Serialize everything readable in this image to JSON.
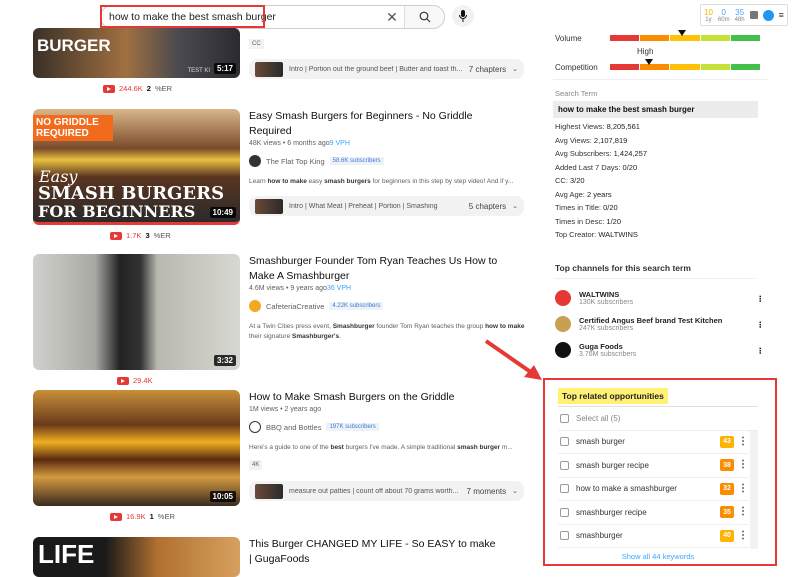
{
  "search": {
    "query": "how to make the best smash burger"
  },
  "extension_stats": {
    "count_1y": "10",
    "label_1y": "1y",
    "count_60m": "0",
    "label_60m": "60m",
    "count_48h": "35",
    "label_48h": "48h"
  },
  "videos": [
    {
      "thumb_text": "BURGER",
      "thumb_tag": "TEST KI",
      "duration": "5:17",
      "views_count": "244.6K",
      "er": "2",
      "er_label": "%ER",
      "badge": "CC",
      "chapters_text": "Intro | Portion out the ground beef | Butter and toast th...",
      "chapters_count": "7 chapters"
    },
    {
      "thumb_tag": "NO GRIDDLE REQUIRED",
      "thumb_script": "Easy",
      "thumb_text": "SMASH BURGERS",
      "thumb_text2": "FOR BEGINNERS",
      "duration": "10:49",
      "views_count": "1.7K",
      "er": "3",
      "er_label": "%ER",
      "title": "Easy Smash Burgers for Beginners - No Griddle Required",
      "views": "48K views • 6 months ago",
      "vph": "9 VPH",
      "channel": "The Flat Top King",
      "subs": "58.6K subscribers",
      "desc_pre": "Learn ",
      "desc_b1": "how to make",
      "desc_mid": " easy ",
      "desc_b2": "smash burgers",
      "desc_post": " for beginners in this step by step video! And if y...",
      "chapters_text": "Intro | What Meat | Preheat | Portion | Smashing",
      "chapters_count": "5 chapters"
    },
    {
      "duration": "3:32",
      "views_count": "29.4K",
      "title": "Smashburger Founder Tom Ryan Teaches Us How to Make A Smashburger",
      "views": "4.6M views • 9 years ago",
      "vph": "36 VPH",
      "channel": "CafeteriaCreative",
      "subs": "4.22K subscribers",
      "desc_pre": "At a Twin Cities press event, ",
      "desc_b1": "Smashburger",
      "desc_mid": " founder Tom Ryan teaches the group ",
      "desc_b2": "how to make",
      "desc_post": " their signature ",
      "desc_b3": "Smashburger's",
      "desc_end": "."
    },
    {
      "duration": "10:05",
      "views_count": "16.9K",
      "er": "1",
      "er_label": "%ER",
      "title": "How to Make Smash Burgers on the Griddle",
      "views": "1M views • 2 years ago",
      "channel": "BBQ and Bottles",
      "subs": "197K subscribers",
      "desc_pre": "Here's a guide to one of the ",
      "desc_b1": "best",
      "desc_mid": " burgers I've made. A simple traditional ",
      "desc_b2": "smash burger",
      "desc_post": " m...",
      "badge": "4K",
      "chapters_text": "measure out patties | count off about 70 grams worth...",
      "chapters_count": "7 moments"
    },
    {
      "thumb_text": "LIFE",
      "title": "This Burger CHANGED MY LIFE - So EASY to make | GugaFoods"
    }
  ],
  "panel": {
    "volume_label": "Volume",
    "competition_label": "Competition",
    "competition_level": "High",
    "volume_level_pct": 45,
    "competition_level_pct": 23,
    "bar_colors": [
      "#e53935",
      "#fb8c00",
      "#ffc107",
      "#c6e03a",
      "#43c04a"
    ],
    "search_term_label": "Search Term",
    "search_term": "how to make the best smash burger",
    "stats": [
      {
        "label": "Highest Views: ",
        "value": "8,205,561"
      },
      {
        "label": "Avg Views: ",
        "value": "2,107,819"
      },
      {
        "label": "Avg Subscribers: ",
        "value": "1,424,257"
      },
      {
        "label": "Added Last 7 Days: ",
        "value": "0/20"
      },
      {
        "label": "CC: ",
        "value": "3/20"
      },
      {
        "label": "Avg Age: ",
        "value": "2 years"
      },
      {
        "label": "Times in Title: ",
        "value": "0/20"
      },
      {
        "label": "Times in Desc: ",
        "value": "1/20"
      },
      {
        "label": "Top Creator: ",
        "value": "WALTWINS"
      }
    ],
    "channels_title": "Top channels for this search term",
    "channels": [
      {
        "name": "WALTWINS",
        "subs": "130K subscribers"
      },
      {
        "name": "Certified Angus Beef brand Test Kitchen",
        "subs": "247K subscribers"
      },
      {
        "name": "Guga Foods",
        "subs": "3.76M subscribers"
      }
    ],
    "opps_title": "Top related opportunities",
    "select_all": "Select all (5)",
    "keywords": [
      {
        "term": "smash burger",
        "score": "43",
        "color": "#ffb300"
      },
      {
        "term": "smash burger recipe",
        "score": "38",
        "color": "#fb8c00"
      },
      {
        "term": "how to make a smashburger",
        "score": "32",
        "color": "#fb8c00"
      },
      {
        "term": "smashburger recipe",
        "score": "35",
        "color": "#fb8c00"
      },
      {
        "term": "smashburger",
        "score": "40",
        "color": "#ffb300"
      }
    ],
    "show_all": "Show all 44 keywords"
  }
}
